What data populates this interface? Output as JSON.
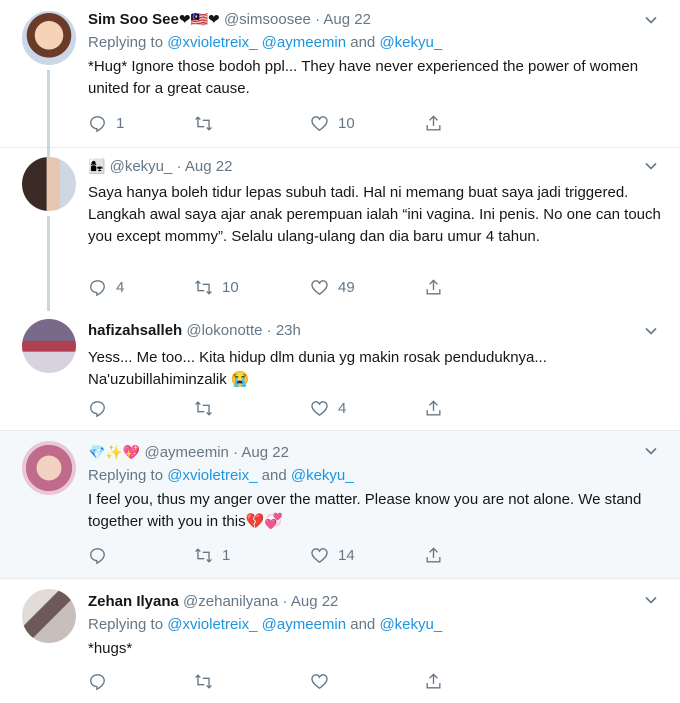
{
  "tweets": [
    {
      "name": "Sim Soo See",
      "name_emoji": "❤🇲🇾❤",
      "handle": "@simsoosee",
      "dot": "·",
      "time": "Aug 22",
      "replying_prefix": "Replying to ",
      "mentions": [
        "@xvioletreix_",
        "@aymeemin",
        "@kekyu_"
      ],
      "joiners": [
        " ",
        " and "
      ],
      "text": "*Hug* Ignore those bodoh ppl... They have never experienced the power of women united for a great cause.",
      "replies": "1",
      "retweets": "",
      "likes": "10"
    },
    {
      "name": "",
      "name_emoji": "👩‍👧",
      "handle": "@kekyu_",
      "dot": "·",
      "time": "Aug 22",
      "text": "Saya hanya boleh tidur lepas subuh tadi. Hal ni memang buat saya jadi triggered. Langkah awal saya ajar anak perempuan ialah “ini vagina. Ini penis. No one can touch you except mommy”. Selalu ulang-ulang dan dia baru umur 4 tahun.",
      "replies": "4",
      "retweets": "10",
      "likes": "49"
    },
    {
      "name": "hafizahsalleh",
      "handle": "@lokonotte",
      "dot": "·",
      "time": "23h",
      "text": "Yess... Me too... Kita hidup dlm dunia yg makin rosak penduduknya... Na'uzubillahiminzalik 😭",
      "replies": "",
      "retweets": "",
      "likes": "4"
    },
    {
      "name": "",
      "name_emoji": "💎✨💖",
      "handle": "@aymeemin",
      "dot": "·",
      "time": "Aug 22",
      "replying_prefix": "Replying to ",
      "mentions": [
        "@xvioletreix_",
        "@kekyu_"
      ],
      "joiners": [
        " and "
      ],
      "text": "I feel you, thus my anger over the matter. Please know you are not alone. We stand together with you in this💔💞",
      "replies": "",
      "retweets": "1",
      "likes": "14"
    },
    {
      "name": "Zehan Ilyana",
      "handle": "@zehanilyana",
      "dot": "·",
      "time": "Aug 22",
      "replying_prefix": "Replying to ",
      "mentions": [
        "@xvioletreix_",
        "@aymeemin",
        "@kekyu_"
      ],
      "joiners": [
        " ",
        " and "
      ],
      "text": "*hugs*",
      "replies": "",
      "retweets": "",
      "likes": ""
    }
  ],
  "icons": {
    "reply": "reply-icon",
    "retweet": "retweet-icon",
    "like": "like-icon",
    "share": "share-icon",
    "more": "chevron-down-icon"
  },
  "colors": {
    "link": "#1b95e0",
    "muted": "#657786",
    "text": "#14171a",
    "border": "#e6ecf0",
    "highlight_bg": "#f5f8fa",
    "thread_line": "#ccd6dd"
  }
}
